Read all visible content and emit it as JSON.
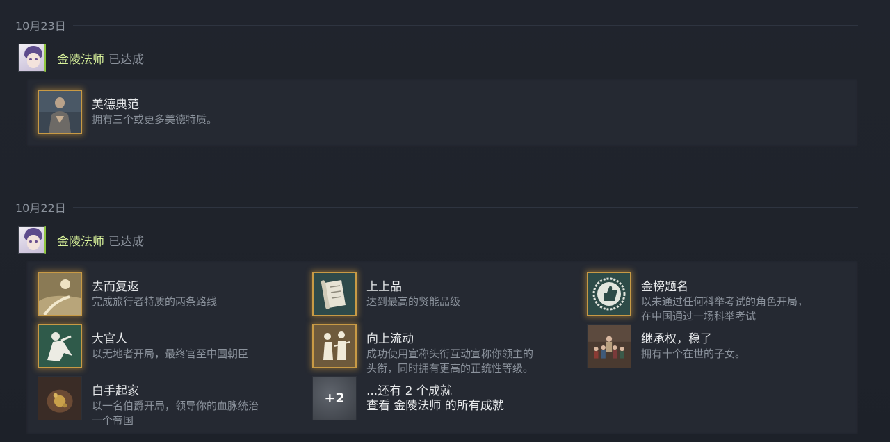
{
  "sections": [
    {
      "date": "10月23日",
      "user": {
        "name": "金陵法师",
        "action": "已达成"
      },
      "achievements": [
        {
          "title": "美德典范",
          "desc": "拥有三个或更多美德特质。",
          "icon": "praying-monk-icon"
        }
      ]
    },
    {
      "date": "10月22日",
      "user": {
        "name": "金陵法师",
        "action": "已达成"
      },
      "achievements": [
        {
          "title": "去而复返",
          "desc": "完成旅行者特质的两条路线",
          "icon": "sun-road-icon"
        },
        {
          "title": "大官人",
          "desc": "以无地者开局，最终官至中国朝臣",
          "icon": "official-figure-icon"
        },
        {
          "title": "白手起家",
          "desc_lines": [
            "以一名伯爵开局，领导你的血脉统治",
            "一个帝国"
          ],
          "icon": "treasure-pouch-icon"
        },
        {
          "title": "上上品",
          "desc": "达到最高的贤能品级",
          "icon": "scroll-icon"
        },
        {
          "title": "向上流动",
          "desc_lines": [
            "成功使用宣称头衔互动宣称你领主的",
            "头衔，同时拥有更高的正统性等级。"
          ],
          "icon": "two-figures-icon"
        },
        {
          "title": "金榜题名",
          "desc_lines": [
            "以未通过任何科举考试的角色开局，",
            "在中国通过一场科举考试"
          ],
          "icon": "thumbs-up-seal-icon"
        },
        {
          "title": "继承权，稳了",
          "desc": "拥有十个在世的子女。",
          "icon": "children-group-icon"
        }
      ],
      "more": {
        "count": "+2",
        "title": "...还有 2 个成就",
        "link": "查看 金陵法师 的所有成就"
      }
    }
  ],
  "colors": {
    "username": "#d8f29a",
    "gold_border": "#c89a45",
    "avatar_bar": "#8fc53f"
  }
}
